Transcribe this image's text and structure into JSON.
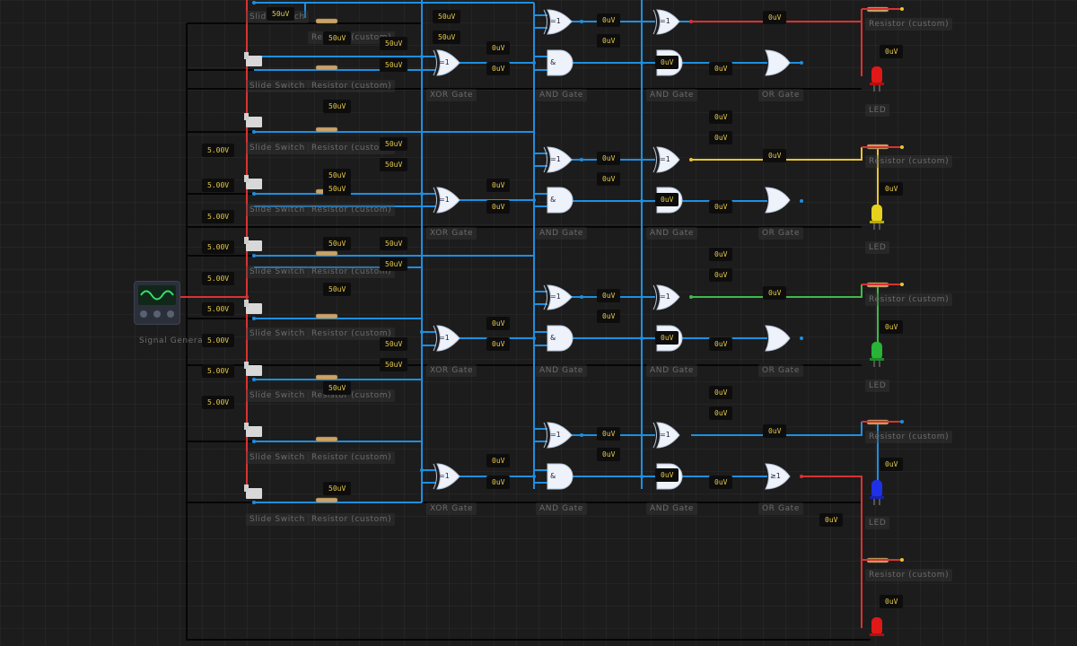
{
  "labels": {
    "signal_generator": "Signal Generato",
    "slide_switch": "Slide Switch",
    "resistor": "Resistor (custom)",
    "xor_gate": "XOR Gate",
    "and_gate": "AND Gate",
    "or_gate": "OR Gate",
    "led": "LED"
  },
  "gate_symbols": {
    "xor": "=1",
    "and": "&",
    "or": "≥1"
  },
  "readouts": {
    "v5": "5.00V",
    "v50u": "50uV",
    "v0u": "0uV"
  },
  "colors": {
    "wire_blue": "#1e8fe0",
    "wire_red": "#d83232",
    "wire_black": "#050505",
    "wire_yellow": "#e8c531",
    "wire_green": "#3fb94a",
    "led_red": "#e01818",
    "led_yellow": "#e6d21c",
    "led_green": "#28b436",
    "led_blue": "#2030e8"
  }
}
